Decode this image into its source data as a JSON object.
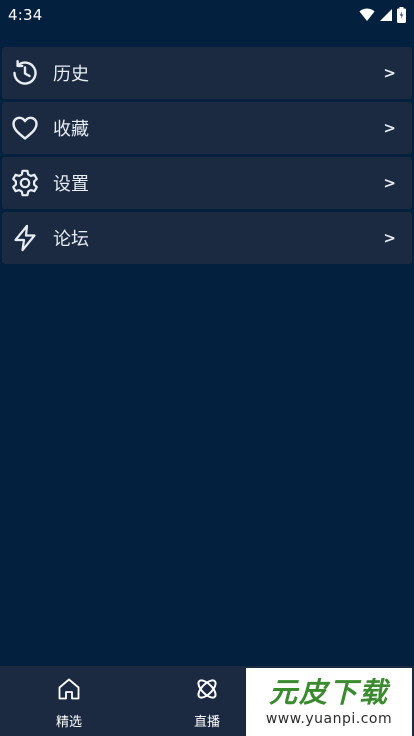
{
  "status_bar": {
    "time": "4:34",
    "icons": [
      "wifi-icon",
      "signal-icon",
      "battery-icon"
    ]
  },
  "menu": {
    "items": [
      {
        "label": "历史",
        "icon": "history-icon",
        "arrow": ">"
      },
      {
        "label": "收藏",
        "icon": "heart-icon",
        "arrow": ">"
      },
      {
        "label": "设置",
        "icon": "gear-icon",
        "arrow": ">"
      },
      {
        "label": "论坛",
        "icon": "lightning-icon",
        "arrow": ">"
      }
    ]
  },
  "bottom_nav": {
    "tabs": [
      {
        "label": "精选",
        "icon": "home-icon"
      },
      {
        "label": "直播",
        "icon": "atom-icon"
      }
    ]
  },
  "watermark": {
    "title": "元皮下载",
    "url": "www.yuanpi.com"
  },
  "colors": {
    "background": "#04203f",
    "item_background": "#1b2a41",
    "text": "#e8edf3",
    "watermark_green": "#3a8a2e"
  }
}
